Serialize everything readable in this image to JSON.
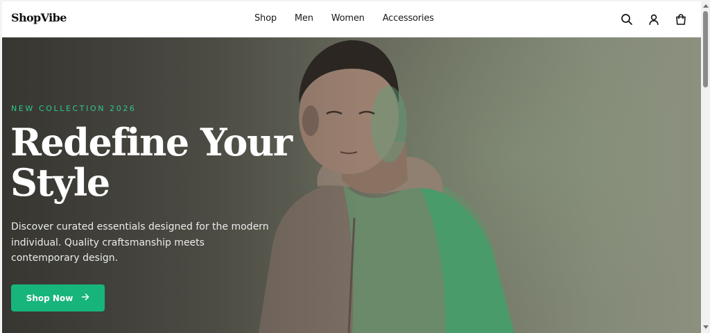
{
  "brand": {
    "name": "ShopVibe"
  },
  "nav": {
    "items": [
      {
        "label": "Shop"
      },
      {
        "label": "Men"
      },
      {
        "label": "Women"
      },
      {
        "label": "Accessories"
      }
    ]
  },
  "header_icons": [
    "search-icon",
    "user-icon",
    "shopping-bag-icon"
  ],
  "hero": {
    "eyebrow": "NEW COLLECTION 2026",
    "headline_line1": "Redefine Your",
    "headline_line2": "Style",
    "description": "Discover curated essentials designed for the modern individual. Quality craftsmanship meets contemporary design.",
    "cta_label": "Shop Now"
  },
  "colors": {
    "accent": "#17b57b",
    "eyebrow": "#2ec88f",
    "headline": "#ffffff",
    "header_bg": "#ffffff"
  }
}
